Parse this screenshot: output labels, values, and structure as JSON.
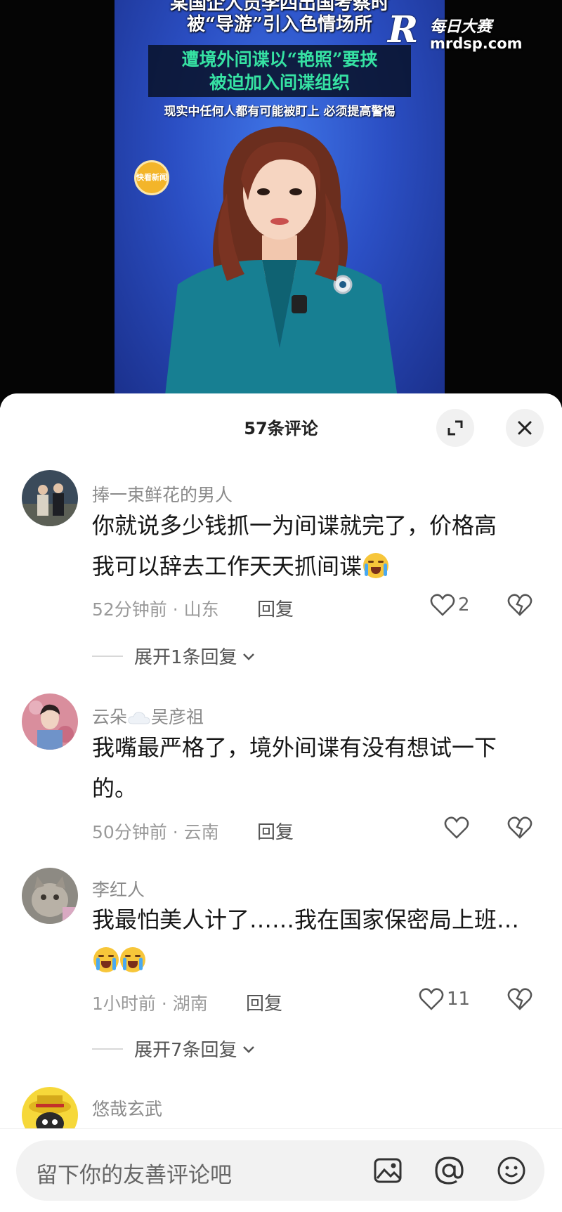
{
  "video": {
    "headline_line1": "某国企人员李四出国考察时",
    "headline_line2": "被“导游”引入色情场所",
    "headline_green_line1": "遭境外间谍以“艳照”要挟",
    "headline_green_line2": "被迫加入间谍组织",
    "subline": "现实中任何人都有可能被盯上 必须提高警惕",
    "channel_logo_text": "快看新闻",
    "watermark_badge": "R",
    "watermark_title": "每日大赛",
    "watermark_domain": "mrdsp.com"
  },
  "sheet": {
    "title": "57条评论",
    "expand_icon": "expand-icon",
    "close_icon": "close-icon"
  },
  "comments": [
    {
      "username": "捧一束鲜花的男人",
      "text": "你就说多少钱抓一为间谍就完了，价格高\n我可以辞去工作天天抓间谍",
      "emoji": "laugh-cry-emoji",
      "meta": "52分钟前 · 山东",
      "reply": "回复",
      "likes": "2",
      "expand_replies": "展开1条回复"
    },
    {
      "username": "云朵",
      "username_suffix": "吴彦祖",
      "username_emoji": "cloud-emoji",
      "text": "我嘴最严格了，境外间谍有没有想试一下\n的。",
      "meta": "50分钟前 · 云南",
      "reply": "回复",
      "likes": ""
    },
    {
      "username": "李红人",
      "text": "我最怕美人计了……我在国家保密局上班…",
      "emoji": "crying-emoji",
      "meta": "1小时前 · 湖南",
      "reply": "回复",
      "likes": "11",
      "expand_replies": "展开7条回复"
    },
    {
      "username": "悠哉玄武"
    }
  ],
  "input": {
    "placeholder": "留下你的友善评论吧",
    "image_icon": "image-icon",
    "at_icon": "at-icon",
    "emoji_icon": "emoji-icon"
  }
}
